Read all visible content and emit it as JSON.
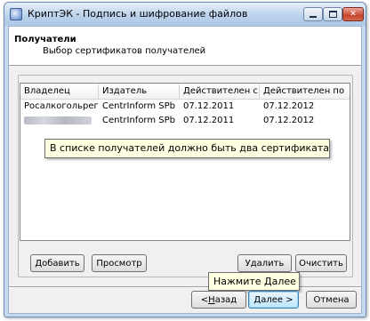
{
  "window": {
    "title": "КриптЭК - Подпись и шифрование файлов",
    "icon": "app-key-icon"
  },
  "header": {
    "title": "Получатели",
    "subtitle": "Выбор сертификатов получателей"
  },
  "table": {
    "columns": [
      "Владелец",
      "Издатель",
      "Действителен с",
      "Действителен по"
    ],
    "rows": [
      {
        "owner": "Росалкогольрегул...",
        "issuer": "CentrInform SPb",
        "from": "07.12.2011",
        "to": "07.12.2012"
      },
      {
        "owner": "",
        "issuer": "CentrInform SPb",
        "from": "07.12.2011",
        "to": "07.12.2012"
      }
    ]
  },
  "callouts": {
    "certs_hint": "В списке получателей должно быть два сертификата",
    "next_hint": "Нажмите Далее"
  },
  "buttons": {
    "add": "Добавить",
    "view": "Просмотр",
    "delete": "Удалить",
    "clear": "Очистить",
    "back_prefix": "< ",
    "back_key": "Н",
    "back_rest": "азад",
    "next_key": "Д",
    "next_rest": "алее >",
    "cancel": "Отмена"
  }
}
